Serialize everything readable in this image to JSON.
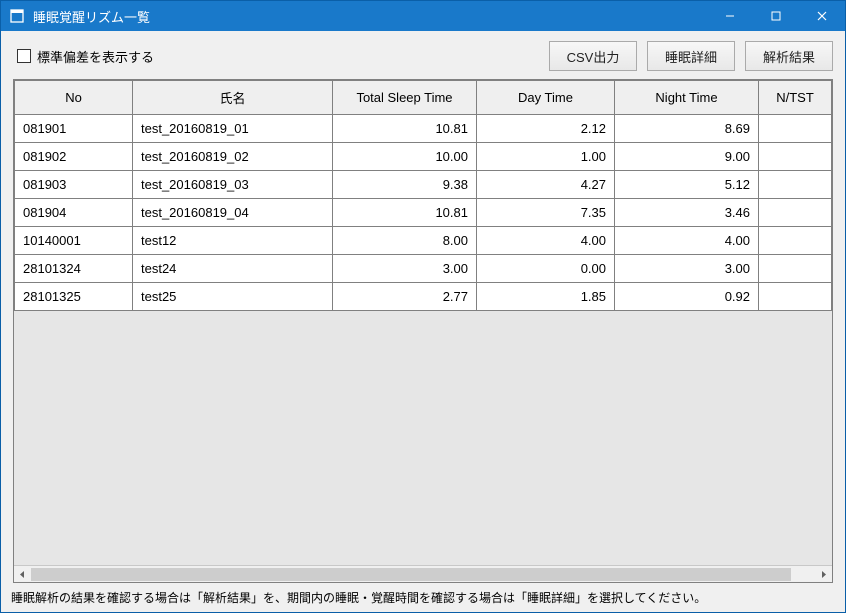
{
  "window": {
    "title": "睡眠覚醒リズム一覧"
  },
  "toolbar": {
    "checkbox_label": "標準偏差を表示する",
    "buttons": {
      "csv": "CSV出力",
      "detail": "睡眠詳細",
      "analysis": "解析結果"
    }
  },
  "table": {
    "columns": {
      "no": "No",
      "name": "氏名",
      "total": "Total Sleep Time",
      "day": "Day Time",
      "night": "Night Time",
      "ntst": "N/TST"
    },
    "rows": [
      {
        "no": "081901",
        "name": "test_20160819_01",
        "total": "10.81",
        "day": "2.12",
        "night": "8.69"
      },
      {
        "no": "081902",
        "name": "test_20160819_02",
        "total": "10.00",
        "day": "1.00",
        "night": "9.00"
      },
      {
        "no": "081903",
        "name": "test_20160819_03",
        "total": "9.38",
        "day": "4.27",
        "night": "5.12"
      },
      {
        "no": "081904",
        "name": "test_20160819_04",
        "total": "10.81",
        "day": "7.35",
        "night": "3.46"
      },
      {
        "no": "10140001",
        "name": "test12",
        "total": "8.00",
        "day": "4.00",
        "night": "4.00"
      },
      {
        "no": "28101324",
        "name": "test24",
        "total": "3.00",
        "day": "0.00",
        "night": "3.00"
      },
      {
        "no": "28101325",
        "name": "test25",
        "total": "2.77",
        "day": "1.85",
        "night": "0.92"
      }
    ]
  },
  "statusbar": {
    "text": "睡眠解析の結果を確認する場合は「解析結果」を、期間内の睡眠・覚醒時間を確認する場合は「睡眠詳細」を選択してください。"
  }
}
